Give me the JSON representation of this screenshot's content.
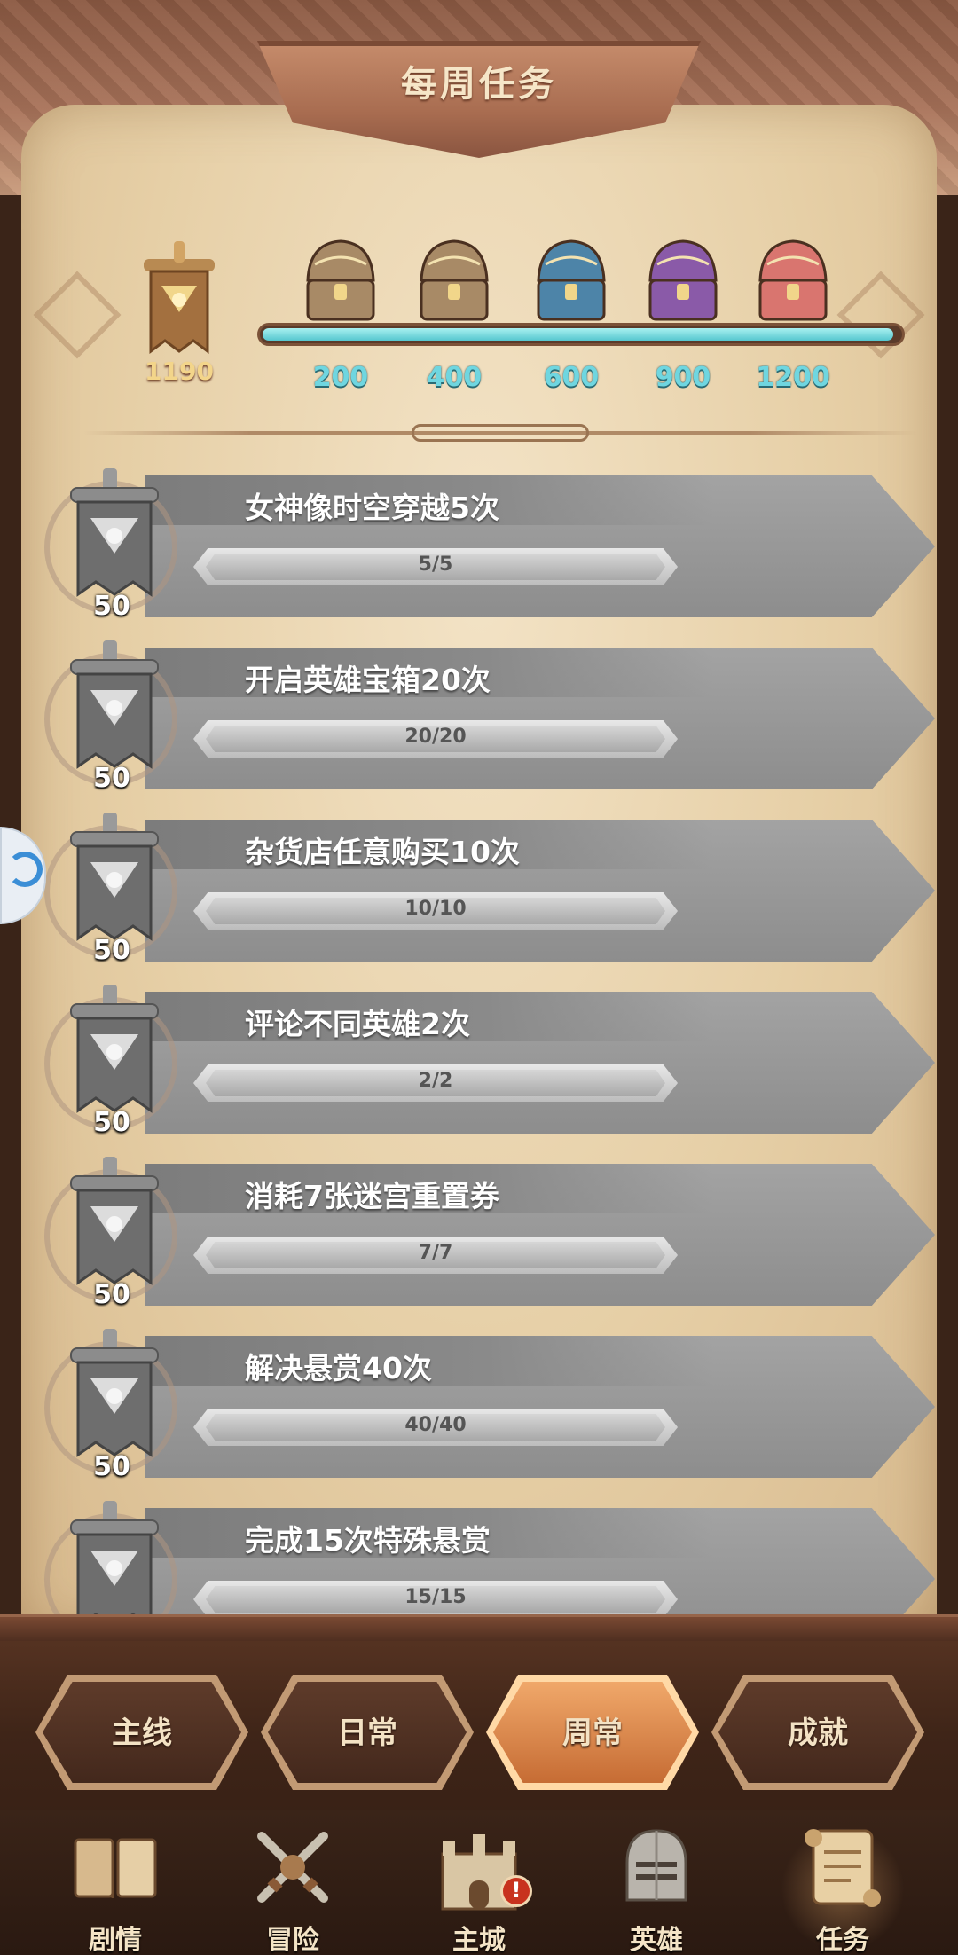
{
  "header": {
    "title": "每周任务"
  },
  "weekly_progress": {
    "score": "1190",
    "fill_fraction": 0.99,
    "milestones": [
      {
        "label": "200",
        "chest": "bronze-chest",
        "color": "#a88a66"
      },
      {
        "label": "400",
        "chest": "bronze-chest",
        "color": "#a88a66"
      },
      {
        "label": "600",
        "chest": "blue-chest",
        "color": "#4d84a8"
      },
      {
        "label": "900",
        "chest": "purple-chest",
        "color": "#8a5aa8"
      },
      {
        "label": "1200",
        "chest": "pink-chest",
        "color": "#d9756f"
      }
    ]
  },
  "tasks": [
    {
      "name": "女神像时空穿越5次",
      "progress": "5/5",
      "reward": "50"
    },
    {
      "name": "开启英雄宝箱20次",
      "progress": "20/20",
      "reward": "50"
    },
    {
      "name": "杂货店任意购买10次",
      "progress": "10/10",
      "reward": "50"
    },
    {
      "name": "评论不同英雄2次",
      "progress": "2/2",
      "reward": "50"
    },
    {
      "name": "消耗7张迷宫重置券",
      "progress": "7/7",
      "reward": "50"
    },
    {
      "name": "解决悬赏40次",
      "progress": "40/40",
      "reward": "50"
    },
    {
      "name": "完成15次特殊悬赏",
      "progress": "15/15",
      "reward": ""
    }
  ],
  "category_tabs": [
    {
      "label": "主线",
      "active": false
    },
    {
      "label": "日常",
      "active": false
    },
    {
      "label": "周常",
      "active": true
    },
    {
      "label": "成就",
      "active": false
    }
  ],
  "bottom_nav": [
    {
      "label": "剧情",
      "icon": "book-icon",
      "active": false,
      "alert": false
    },
    {
      "label": "冒险",
      "icon": "crossed-swords-icon",
      "active": false,
      "alert": false
    },
    {
      "label": "主城",
      "icon": "castle-icon",
      "active": false,
      "alert": true
    },
    {
      "label": "英雄",
      "icon": "helmet-icon",
      "active": false,
      "alert": false
    },
    {
      "label": "任务",
      "icon": "quest-scroll-icon",
      "active": true,
      "alert": false
    }
  ],
  "alert_glyph": "!",
  "colors": {
    "accent": "#6fd6e0",
    "active_tab": "#e0904f",
    "completed_bar": "#9a9a9a"
  }
}
